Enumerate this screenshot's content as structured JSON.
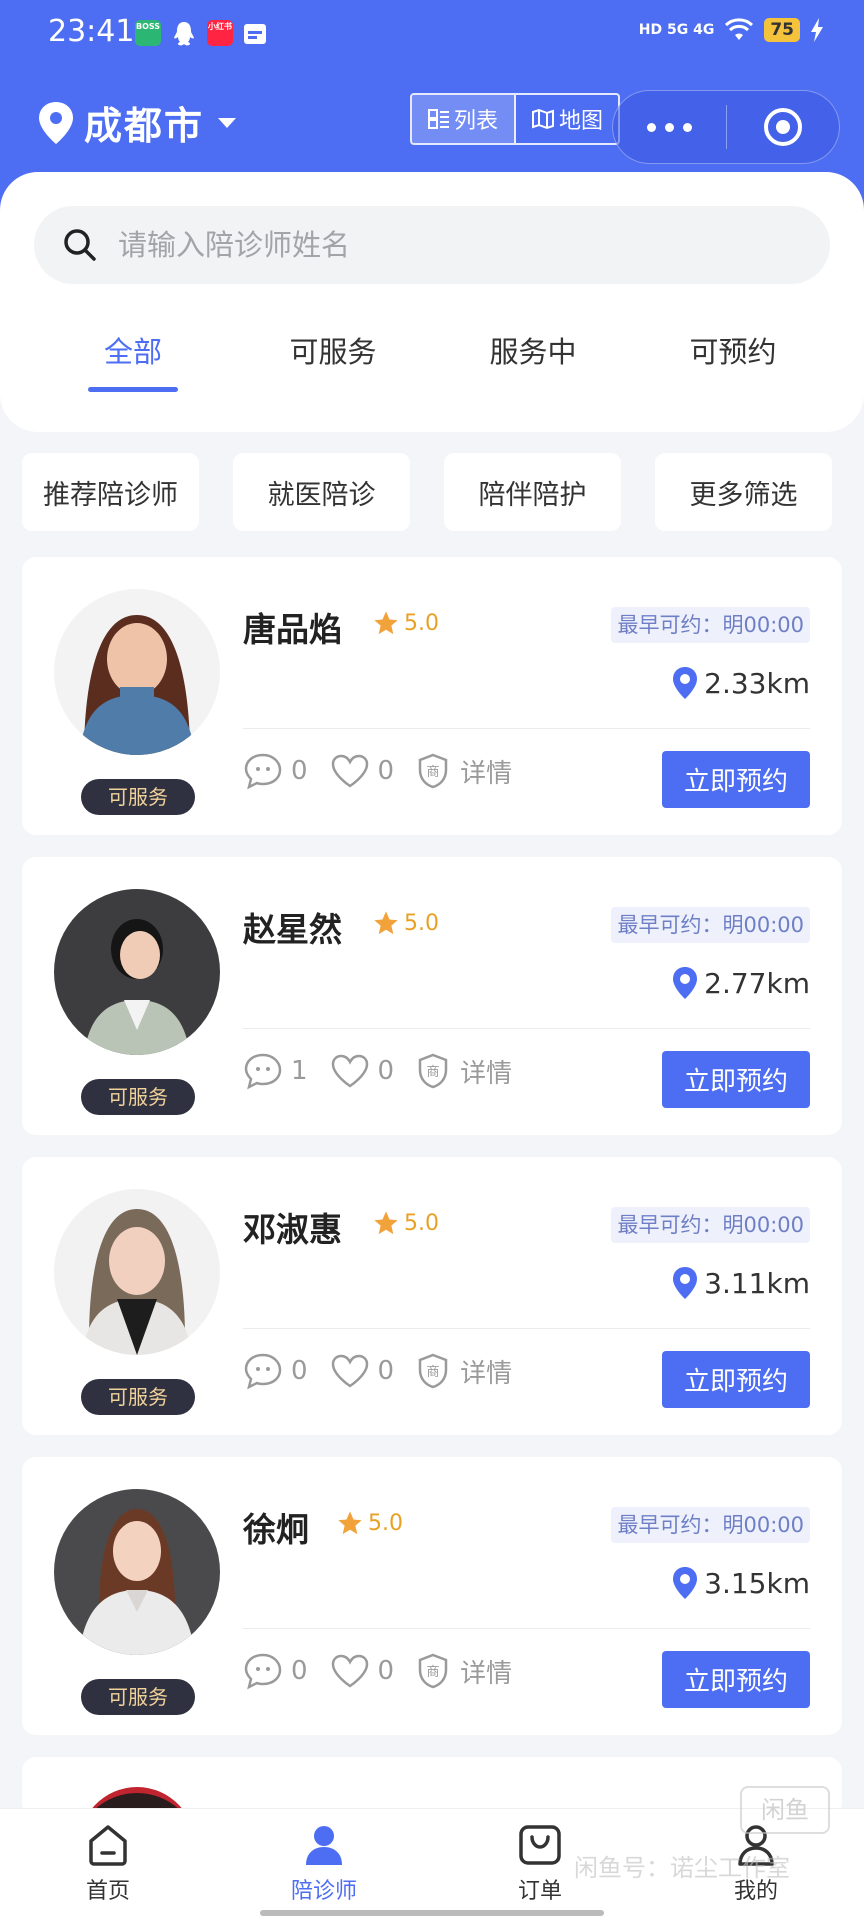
{
  "status_bar": {
    "time": "23:41",
    "apps": [
      "BOSS直聘",
      "小红书"
    ],
    "network": "HD 5G 4G",
    "battery": "75"
  },
  "header": {
    "city": "成都市",
    "view_toggle": {
      "list": "列表",
      "map": "地图"
    }
  },
  "search": {
    "placeholder": "请输入陪诊师姓名"
  },
  "tabs": [
    {
      "label": "全部",
      "active": true
    },
    {
      "label": "可服务"
    },
    {
      "label": "服务中"
    },
    {
      "label": "可预约"
    }
  ],
  "filters": [
    "推荐陪诊师",
    "就医陪诊",
    "陪伴陪护",
    "更多筛选"
  ],
  "companions": [
    {
      "name": "唐品焰",
      "rating": "5.0",
      "earliest": "最早可约：明00:00",
      "distance": "2.33km",
      "comments": "0",
      "likes": "0",
      "merchant": "商",
      "detail": "详情",
      "status": "可服务",
      "book": "立即预约"
    },
    {
      "name": "赵星然",
      "rating": "5.0",
      "earliest": "最早可约：明00:00",
      "distance": "2.77km",
      "comments": "1",
      "likes": "0",
      "merchant": "商",
      "detail": "详情",
      "status": "可服务",
      "book": "立即预约"
    },
    {
      "name": "邓淑惠",
      "rating": "5.0",
      "earliest": "最早可约：明00:00",
      "distance": "3.11km",
      "comments": "0",
      "likes": "0",
      "merchant": "商",
      "detail": "详情",
      "status": "可服务",
      "book": "立即预约"
    },
    {
      "name": "徐炯",
      "rating": "5.0",
      "earliest": "最早可约：明00:00",
      "distance": "3.15km",
      "comments": "0",
      "likes": "0",
      "merchant": "商",
      "detail": "详情",
      "status": "可服务",
      "book": "立即预约"
    }
  ],
  "tabbar": [
    {
      "label": "首页",
      "icon": "home-icon"
    },
    {
      "label": "陪诊师",
      "icon": "person-icon",
      "active": true
    },
    {
      "label": "订单",
      "icon": "order-icon"
    },
    {
      "label": "我的",
      "icon": "profile-icon"
    }
  ],
  "watermark": {
    "logo": "闲鱼",
    "text": "闲鱼号：诺尘工作室"
  },
  "colors": {
    "primary": "#4d6ef2",
    "star": "#f2a23a",
    "badge_bg": "#2f3140",
    "badge_text": "#f1d39a"
  }
}
